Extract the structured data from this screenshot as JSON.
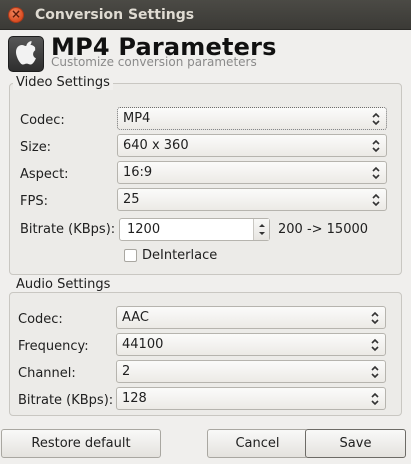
{
  "window": {
    "title": "Conversion Settings",
    "close_glyph": "×"
  },
  "header": {
    "title": "MP4 Parameters",
    "subtitle": "Customize conversion parameters",
    "logo_icon": "apple-icon"
  },
  "video": {
    "group_title": "Video Settings",
    "codec": {
      "label": "Codec:",
      "value": "MP4"
    },
    "size": {
      "label": "Size:",
      "value": "640 x 360"
    },
    "aspect": {
      "label": "Aspect:",
      "value": "16:9"
    },
    "fps": {
      "label": "FPS:",
      "value": "25"
    },
    "bitrate": {
      "label": "Bitrate (KBps):",
      "value": "1200",
      "range": "200 -> 15000"
    },
    "deinterlace": {
      "label": "DeInterlace",
      "checked": false
    }
  },
  "audio": {
    "group_title": "Audio Settings",
    "codec": {
      "label": "Codec:",
      "value": "AAC"
    },
    "frequency": {
      "label": "Frequency:",
      "value": "44100"
    },
    "channel": {
      "label": "Channel:",
      "value": "2"
    },
    "bitrate": {
      "label": "Bitrate (KBps):",
      "value": "128"
    }
  },
  "buttons": {
    "restore": "Restore default",
    "cancel": "Cancel",
    "save": "Save"
  }
}
